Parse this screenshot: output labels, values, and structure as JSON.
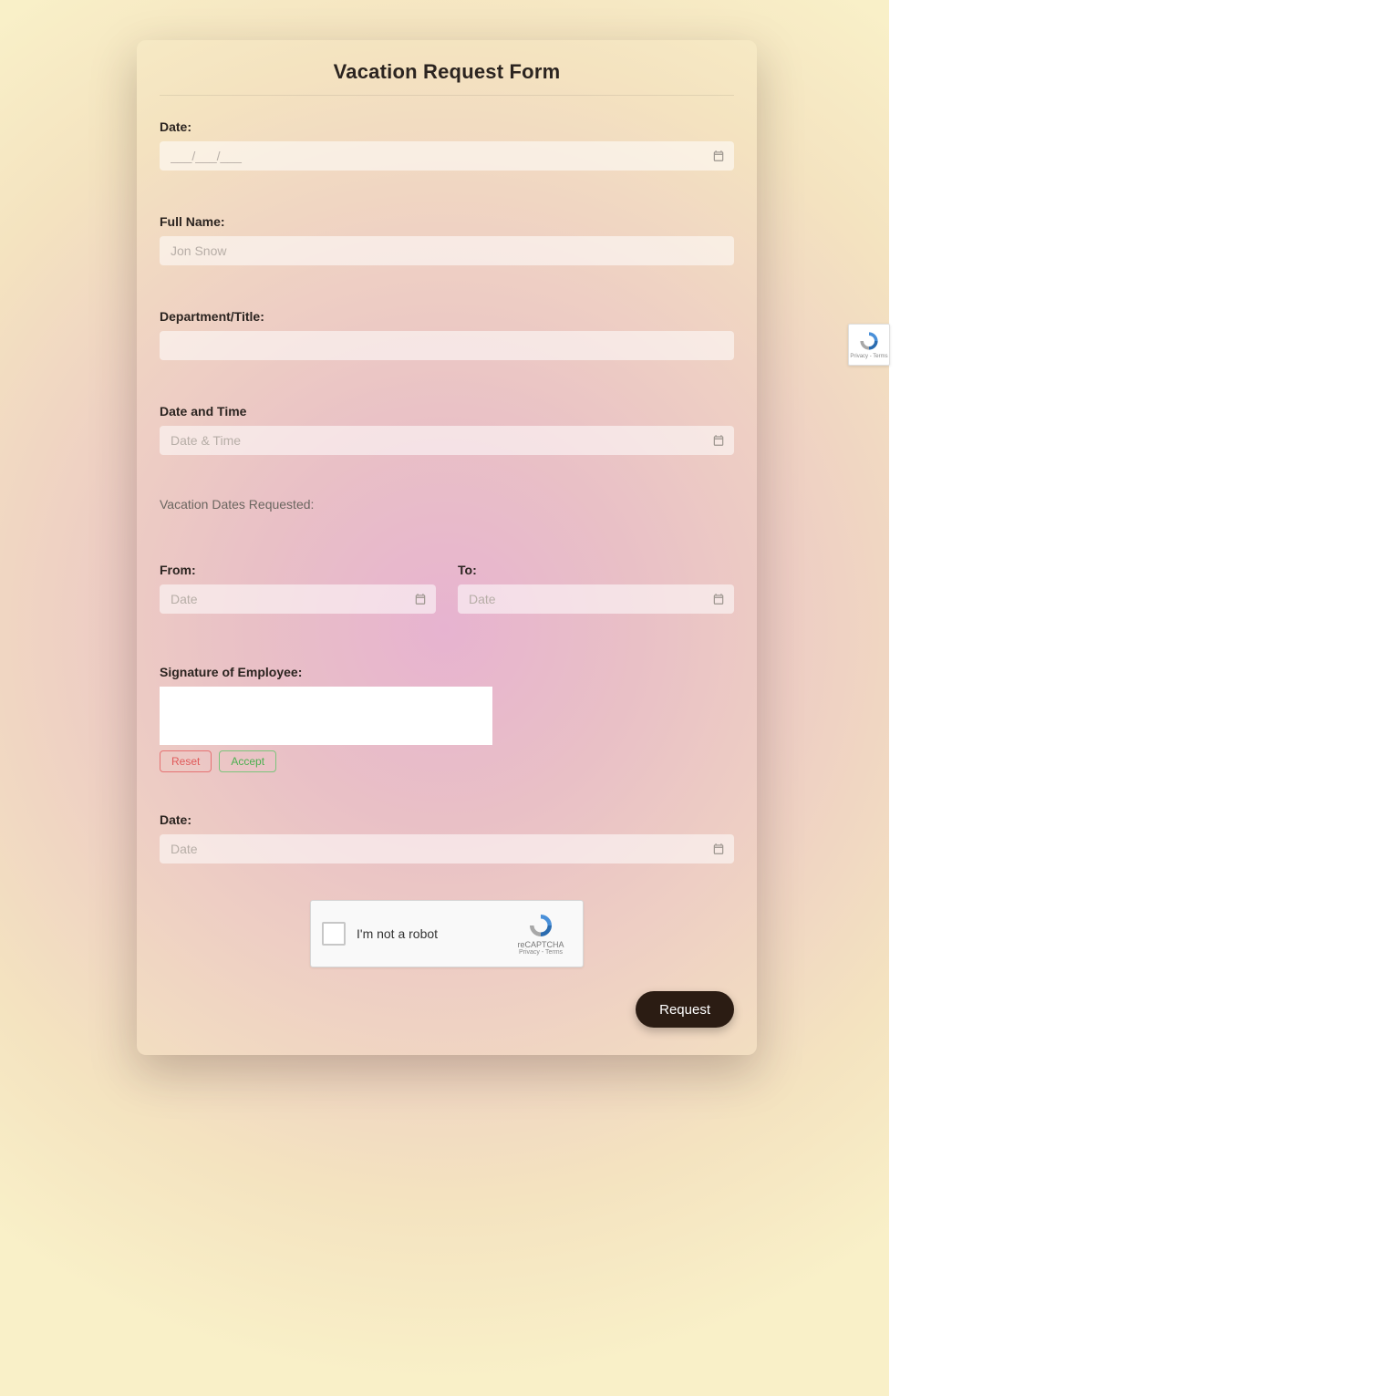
{
  "form": {
    "title": "Vacation Request Form",
    "fields": {
      "date1": {
        "label": "Date:",
        "placeholder": "___/___/___"
      },
      "fullName": {
        "label": "Full Name:",
        "placeholder": "Jon Snow"
      },
      "departmentTitle": {
        "label": "Department/Title:",
        "placeholder": ""
      },
      "dateTime": {
        "label": "Date and Time",
        "placeholder": "Date & Time"
      },
      "vacationNote": "Vacation Dates Requested:",
      "from": {
        "label": "From:",
        "placeholder": "Date"
      },
      "to": {
        "label": "To:",
        "placeholder": "Date"
      },
      "signature": {
        "label": "Signature of Employee:"
      },
      "date2": {
        "label": "Date:",
        "placeholder": "Date"
      }
    },
    "signatureButtons": {
      "reset": "Reset",
      "accept": "Accept"
    },
    "recaptcha": {
      "label": "I'm not a robot",
      "brand": "reCAPTCHA",
      "links": "Privacy - Terms"
    },
    "submit": "Request"
  }
}
